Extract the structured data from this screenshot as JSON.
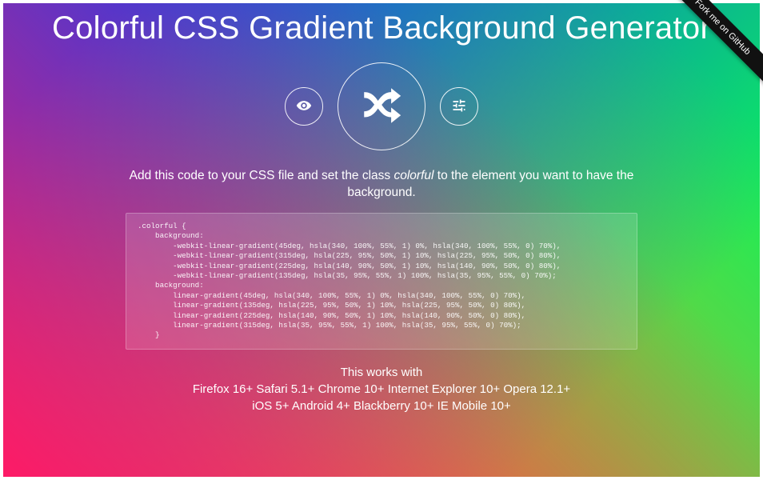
{
  "title": "Colorful CSS Gradient Background Generator",
  "ribbon": "Fork me on GitHub",
  "instructions": {
    "pre": "Add this code to your CSS file and set the class ",
    "class_name": "colorful",
    "post": " to the element you want to have the background."
  },
  "code": ".colorful {\n    background:\n        -webkit-linear-gradient(45deg, hsla(340, 100%, 55%, 1) 0%, hsla(340, 100%, 55%, 0) 70%),\n        -webkit-linear-gradient(315deg, hsla(225, 95%, 50%, 1) 10%, hsla(225, 95%, 50%, 0) 80%),\n        -webkit-linear-gradient(225deg, hsla(140, 90%, 50%, 1) 10%, hsla(140, 90%, 50%, 0) 80%),\n        -webkit-linear-gradient(135deg, hsla(35, 95%, 55%, 1) 100%, hsla(35, 95%, 55%, 0) 70%);\n    background:\n        linear-gradient(45deg, hsla(340, 100%, 55%, 1) 0%, hsla(340, 100%, 55%, 0) 70%),\n        linear-gradient(135deg, hsla(225, 95%, 50%, 1) 10%, hsla(225, 95%, 50%, 0) 80%),\n        linear-gradient(225deg, hsla(140, 90%, 50%, 1) 10%, hsla(140, 90%, 50%, 0) 80%),\n        linear-gradient(315deg, hsla(35, 95%, 55%, 1) 100%, hsla(35, 95%, 55%, 0) 70%);\n    }",
  "compat": {
    "heading": "This works with",
    "line1": "Firefox 16+ Safari 5.1+ Chrome 10+ Internet Explorer 10+ Opera 12.1+",
    "line2": "iOS 5+ Android 4+ Blackberry 10+ IE Mobile 10+"
  },
  "gradient_colors": {
    "g1": "hsla(340,100%,55%,1)",
    "g2": "hsla(225,95%,50%,1)",
    "g3": "hsla(140,90%,50%,1)",
    "g4": "hsla(35,95%,55%,1)"
  }
}
